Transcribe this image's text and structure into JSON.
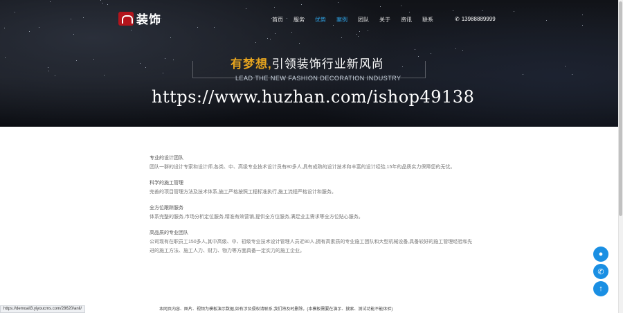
{
  "logo": {
    "text": "装饰"
  },
  "nav": {
    "items": [
      {
        "label": "首页",
        "active": false
      },
      {
        "label": "服务",
        "active": false
      },
      {
        "label": "优势",
        "active": true
      },
      {
        "label": "案例",
        "active": true
      },
      {
        "label": "团队",
        "active": false
      },
      {
        "label": "关于",
        "active": false
      },
      {
        "label": "资讯",
        "active": false
      },
      {
        "label": "联系",
        "active": false
      }
    ],
    "phone": "13988889999",
    "accent": "#2fa4e7"
  },
  "hero": {
    "slogan_gold": "有梦想,",
    "slogan_white": "引领装饰行业新风尚",
    "sub_slogan": "LEAD THE NEW FASHION DECORATION INDUSTRY",
    "watermark": "https://www.huzhan.com/ishop49138"
  },
  "content": {
    "sections": [
      {
        "heading": "专业的设计团队",
        "text": "团队一群的设计专家和设计师,各类、中、高级专业技术设计员有80多人,具有成熟的设计技术和丰富的设计经验,15年的品质实力保障您的无忧。"
      },
      {
        "heading": "科学的施工管理",
        "text": "完善的项目管理方法及技术体系,施工严格按照工程标准执行,施工流程严格设计和服务。"
      },
      {
        "heading": "全方位跟踪服务",
        "text": "体系完整的服务,市场分析定位服务,精准有效营销,提供全方位服务,满足业主需求等全方位贴心服务。"
      },
      {
        "heading": "高品质的专业团队",
        "text": "公司现有在职员工150多人,其中高级、中、初级专业技术设计管理人员近80人,拥有高素质的专业施工团队和大型机械设备,具备较好的施工管理经验和先进的施工方法、施工人力、财力、物力等方面具备一定实力的施工企业。"
      }
    ]
  },
  "footer_note": "本网页内容、图片、视频为模板演示数据,如有涉及侵权请联系,我们将及时删除。(本模板需要在演示、搜索、测试功能不能体验)",
  "statusbar": {
    "url": "https://demoall3.yiyoucms.com/28620/anli/"
  },
  "fabs": [
    {
      "icon": "qq-icon"
    },
    {
      "icon": "phone-icon"
    },
    {
      "icon": "arrow-up-icon"
    }
  ]
}
